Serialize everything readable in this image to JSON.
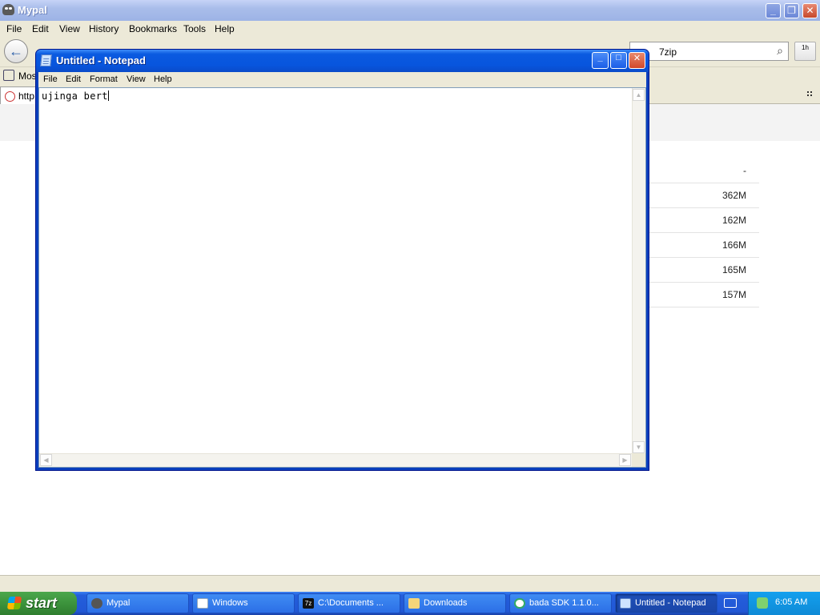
{
  "browser": {
    "title": "Mypal",
    "menu": [
      "File",
      "Edit",
      "View",
      "History",
      "Bookmarks",
      "Tools",
      "Help"
    ],
    "search_value": "7zip",
    "download_label": "1h",
    "bookmark_label": "Most",
    "tab_label": "http"
  },
  "page": {
    "sizes": [
      "-",
      "362M",
      "162M",
      "166M",
      "165M",
      "157M"
    ]
  },
  "notepad": {
    "title": "Untitled - Notepad",
    "menu": [
      "File",
      "Edit",
      "Format",
      "View",
      "Help"
    ],
    "text": "ujinga bert"
  },
  "taskbar": {
    "start": "start",
    "items": [
      "Mypal",
      "Windows",
      "C:\\Documents ...",
      "Downloads",
      "bada SDK 1.1.0...",
      "Untitled - Notepad"
    ],
    "time": "6:05 AM"
  }
}
